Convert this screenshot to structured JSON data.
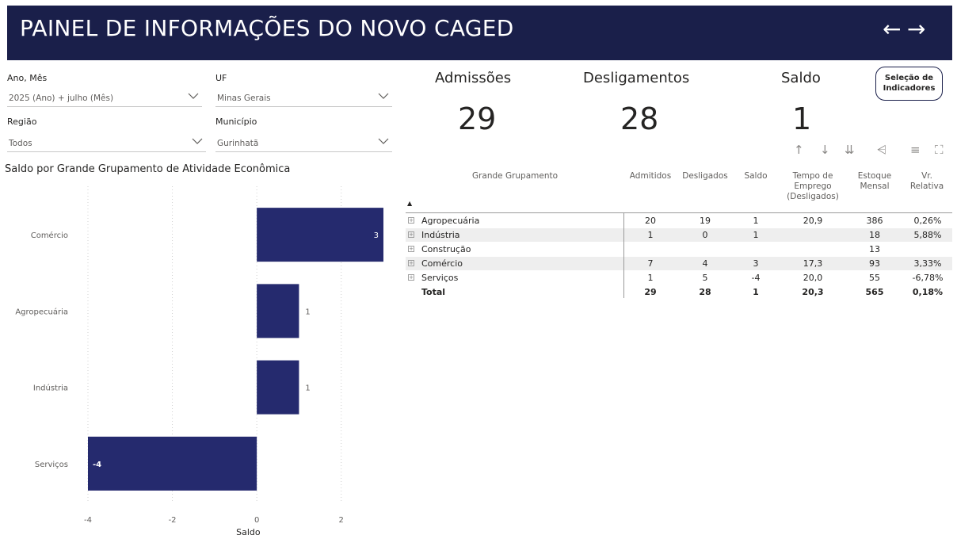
{
  "header": {
    "title": "PAINEL DE INFORMAÇÕES DO NOVO CAGED",
    "back_icon": "←",
    "forward_icon": "→",
    "bg_color": "#1a1f4a"
  },
  "filters": {
    "ano_mes": {
      "label": "Ano, Mês",
      "value": "2025 (Ano) + julho (Mês)"
    },
    "uf": {
      "label": "UF",
      "value": "Minas Gerais"
    },
    "regiao": {
      "label": "Região",
      "value": "Todos"
    },
    "municipio": {
      "label": "Município",
      "value": "Gurinhatã"
    }
  },
  "kpis": {
    "admissoes": {
      "label": "Admissões",
      "value": "29"
    },
    "desligamentos": {
      "label": "Desligamentos",
      "value": "28"
    },
    "saldo": {
      "label": "Saldo",
      "value": "1"
    }
  },
  "selection_button": {
    "label_line1": "Seleção de",
    "label_line2": "Indicadores"
  },
  "toolbar": {
    "sort_up": "↑",
    "sort_down": "↓",
    "expand_all": "⇊",
    "hierarchy": "⩤",
    "filter": "≡",
    "focus": "⛶"
  },
  "chart_data": {
    "type": "bar",
    "orientation": "horizontal",
    "title": "Saldo por Grande Grupamento de Atividade Econômica",
    "categories": [
      "Comércio",
      "Agropecuária",
      "Indústria",
      "Serviços"
    ],
    "values": [
      3,
      1,
      1,
      -4
    ],
    "value_labels": [
      "3",
      "1",
      "1",
      "-4"
    ],
    "xlabel": "Saldo",
    "ylabel": "",
    "xlim": [
      -4,
      3
    ],
    "ticks": [
      -4,
      -2,
      0,
      2
    ],
    "tick_labels": [
      "-4",
      "-2",
      "0",
      "2"
    ],
    "grid": true,
    "bar_color": "#252a6e"
  },
  "matrix": {
    "sort_indicator": "▲",
    "headers": {
      "grupamento": "Grande Grupamento",
      "admitidos": "Admitidos",
      "desligados": "Desligados",
      "saldo": "Saldo",
      "tempo_l1": "Tempo de",
      "tempo_l2": "Emprego",
      "tempo_l3": "(Desligados)",
      "estoque_l1": "Estoque",
      "estoque_l2": "Mensal",
      "vr_l1": "Vr.",
      "vr_l2": "Relativa"
    },
    "expand_icon": "+",
    "rows": [
      {
        "name": "Agropecuária",
        "admitidos": "20",
        "desligados": "19",
        "saldo": "1",
        "tempo": "20,9",
        "estoque": "386",
        "vr": "0,26%"
      },
      {
        "name": "Indústria",
        "admitidos": "1",
        "desligados": "0",
        "saldo": "1",
        "tempo": "",
        "estoque": "18",
        "vr": "5,88%"
      },
      {
        "name": "Construção",
        "admitidos": "",
        "desligados": "",
        "saldo": "",
        "tempo": "",
        "estoque": "13",
        "vr": ""
      },
      {
        "name": "Comércio",
        "admitidos": "7",
        "desligados": "4",
        "saldo": "3",
        "tempo": "17,3",
        "estoque": "93",
        "vr": "3,33%"
      },
      {
        "name": "Serviços",
        "admitidos": "1",
        "desligados": "5",
        "saldo": "-4",
        "tempo": "20,0",
        "estoque": "55",
        "vr": "-6,78%"
      }
    ],
    "total": {
      "name": "Total",
      "admitidos": "29",
      "desligados": "28",
      "saldo": "1",
      "tempo": "20,3",
      "estoque": "565",
      "vr": "0,18%"
    }
  }
}
